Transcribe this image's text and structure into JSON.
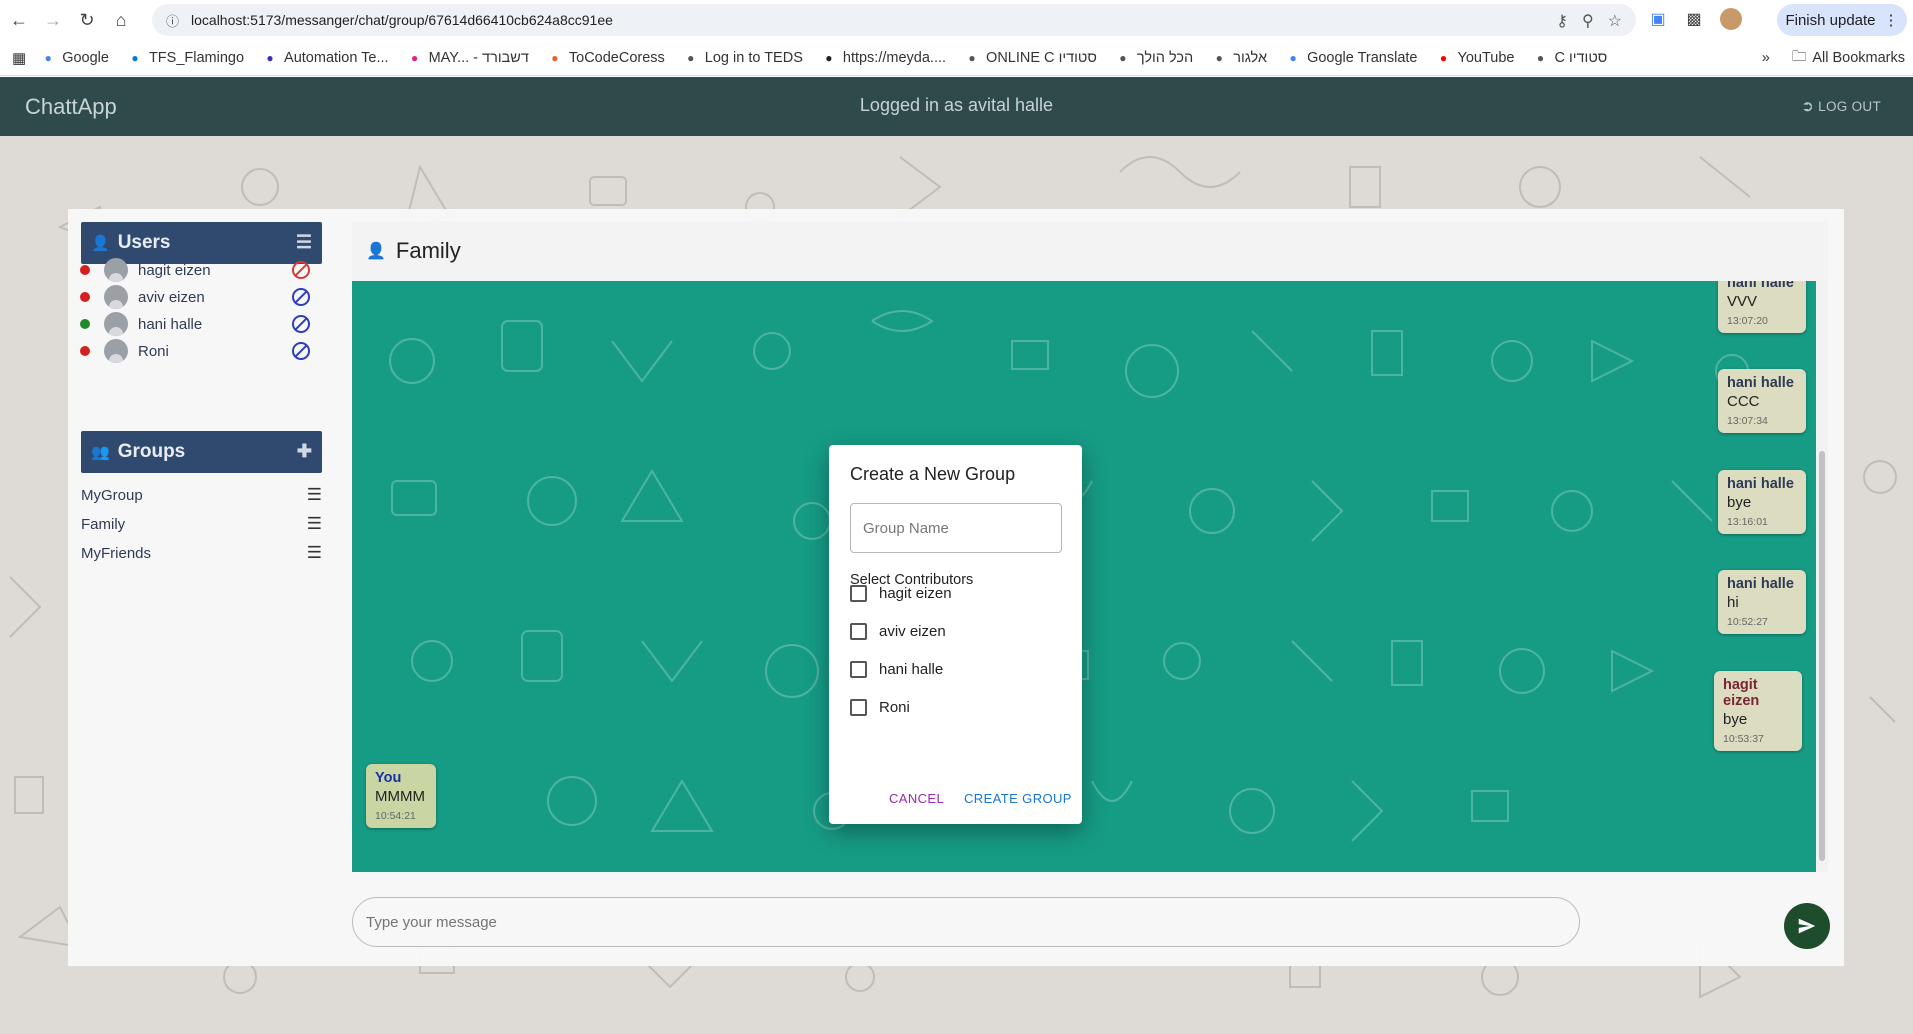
{
  "browser": {
    "url": "localhost:5173/messanger/chat/group/67614d66410cb624a8cc91ee",
    "finish_update": "Finish update",
    "bookmarks": [
      {
        "label": "Google",
        "icon": "google-icon",
        "color": "#4285f4"
      },
      {
        "label": "TFS_Flamingo",
        "icon": "tfs-icon",
        "color": "#0078d4"
      },
      {
        "label": "Automation Te...",
        "icon": "p-icon",
        "color": "#3a2fb8"
      },
      {
        "label": "MAY... - דשבורד",
        "icon": "heart-icon",
        "color": "#e0218a"
      },
      {
        "label": "ToCodeCoress",
        "icon": "tocode-icon",
        "color": "#e8632b"
      },
      {
        "label": "Log in to TEDS",
        "icon": "teds-icon",
        "color": "#555555"
      },
      {
        "label": "https://meyda....",
        "icon": "meyda-icon",
        "color": "#222222"
      },
      {
        "label": "ONLINE C סטודיו",
        "icon": "globe-icon",
        "color": "#555555"
      },
      {
        "label": "הכל הולך",
        "icon": "globe-icon",
        "color": "#555555"
      },
      {
        "label": "אלגור",
        "icon": "globe-icon",
        "color": "#555555"
      },
      {
        "label": "Google Translate",
        "icon": "translate-icon",
        "color": "#4285f4"
      },
      {
        "label": "YouTube",
        "icon": "youtube-icon",
        "color": "#ff0000"
      },
      {
        "label": "C סטודיו",
        "icon": "globe-icon",
        "color": "#555555"
      }
    ],
    "more": "»",
    "all_bookmarks": "All Bookmarks"
  },
  "header": {
    "brand": "ChattApp",
    "logged_in": "Logged in as avital halle",
    "logout": "LOG OUT"
  },
  "users": {
    "title": "Users",
    "items": [
      {
        "name": "hagit eizen",
        "status_color": "#d41f1f",
        "blocked": true
      },
      {
        "name": "aviv eizen",
        "status_color": "#d41f1f",
        "blocked": false
      },
      {
        "name": "hani halle",
        "status_color": "#1f8a2a",
        "blocked": false
      },
      {
        "name": "Roni",
        "status_color": "#d41f1f",
        "blocked": false
      }
    ]
  },
  "groups": {
    "title": "Groups",
    "items": [
      {
        "name": "MyGroup"
      },
      {
        "name": "Family"
      },
      {
        "name": "MyFriends"
      }
    ]
  },
  "chat": {
    "title": "Family",
    "messages": [
      {
        "author": "hani halle",
        "text": "VVV",
        "time": "13:07:20"
      },
      {
        "author": "hani halle",
        "text": "CCC",
        "time": "13:07:34"
      },
      {
        "author": "hani halle",
        "text": "bye",
        "time": "13:16:01"
      },
      {
        "author": "hani halle",
        "text": "hi",
        "time": "10:52:27"
      },
      {
        "author": "hagit eizen",
        "text": "bye",
        "time": "10:53:37"
      },
      {
        "author": "You",
        "text": "MMMM",
        "time": "10:54:21"
      }
    ],
    "input_placeholder": "Type your message"
  },
  "modal": {
    "title": "Create a New Group",
    "group_name_placeholder": "Group Name",
    "contributors_label": "Select Contributors",
    "contributors": [
      {
        "name": "hagit eizen",
        "checked": false
      },
      {
        "name": "aviv eizen",
        "checked": false
      },
      {
        "name": "hani halle",
        "checked": false
      },
      {
        "name": "Roni",
        "checked": false
      }
    ],
    "cancel": "CANCEL",
    "create": "CREATE GROUP"
  },
  "colors": {
    "header": "#2f4a4b",
    "panel": "#2f4a6e",
    "chat_bg": "#169c85",
    "cancel": "#9c27b0",
    "create": "#1976d2"
  }
}
